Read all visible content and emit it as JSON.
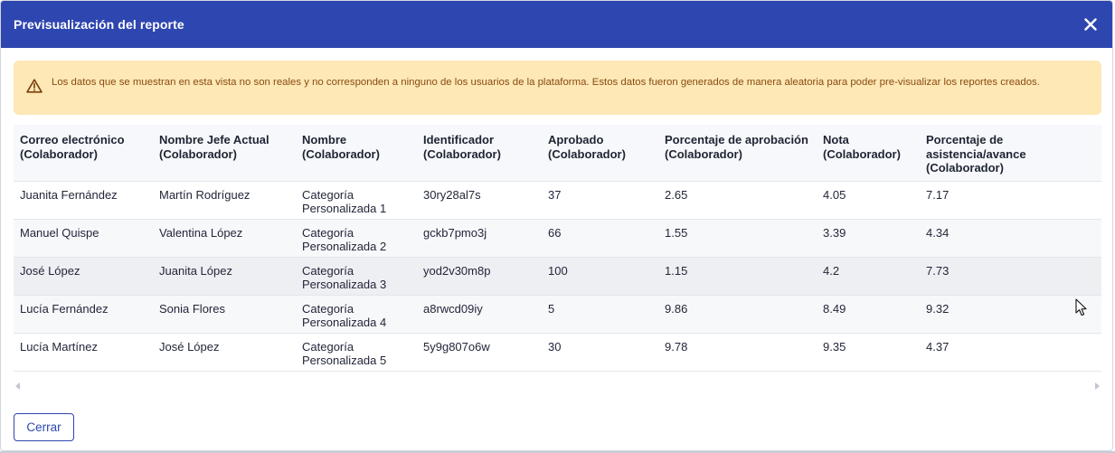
{
  "modal": {
    "title": "Previsualización del reporte",
    "close_icon": "close-icon",
    "alert_icon": "warning-icon",
    "alert_text": "Los datos que se muestran en esta vista no son reales y no corresponden a ninguno de los usuarios de la plataforma. Estos datos fueron generados de manera aleatoria para poder pre-visualizar los reportes creados.",
    "close_button": "Cerrar"
  },
  "colors": {
    "header": "#2e46af",
    "alert_bg": "#fde8b6",
    "alert_text": "#8a4b0f"
  },
  "table": {
    "columns": [
      "Correo electrónico (Colaborador)",
      "Nombre Jefe Actual (Colaborador)",
      "Nombre (Colaborador)",
      "Identificador (Colaborador)",
      "Aprobado (Colaborador)",
      "Porcentaje de aprobación (Colaborador)",
      "Nota (Colaborador)",
      "Porcentaje de asistencia/avance (Colaborador)"
    ],
    "rows": [
      [
        "Juanita Fernández",
        "Martín Rodríguez",
        "Categoría Personalizada 1",
        "30ry28al7s",
        "37",
        "2.65",
        "4.05",
        "7.17"
      ],
      [
        "Manuel Quispe",
        "Valentina López",
        "Categoría Personalizada 2",
        "gckb7pmo3j",
        "66",
        "1.55",
        "3.39",
        "4.34"
      ],
      [
        "José López",
        "Juanita López",
        "Categoría Personalizada 3",
        "yod2v30m8p",
        "100",
        "1.15",
        "4.2",
        "7.73"
      ],
      [
        "Lucía Fernández",
        "Sonia Flores",
        "Categoría Personalizada 4",
        "a8rwcd09iy",
        "5",
        "9.86",
        "8.49",
        "9.32"
      ],
      [
        "Lucía Martínez",
        "José López",
        "Categoría Personalizada 5",
        "5y9g807o6w",
        "30",
        "9.78",
        "9.35",
        "4.37"
      ]
    ]
  }
}
